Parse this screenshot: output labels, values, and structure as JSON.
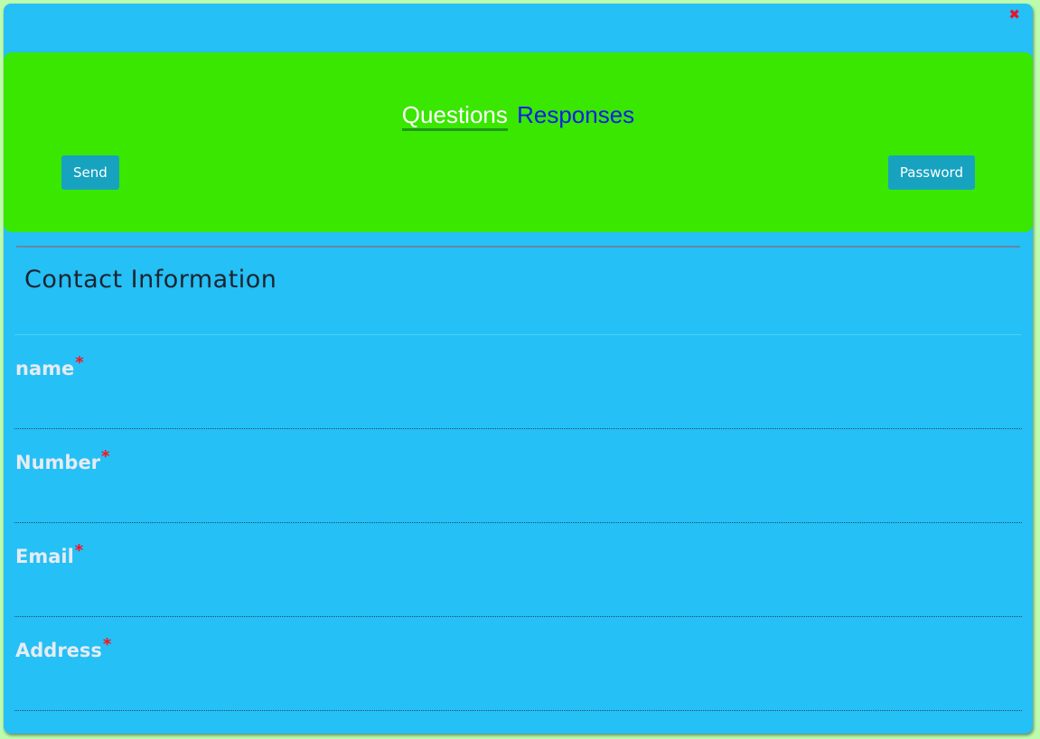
{
  "window": {
    "close_symbol": "✖"
  },
  "header": {
    "tabs": [
      {
        "label": "Questions",
        "active": true
      },
      {
        "label": "Responses",
        "active": false
      }
    ],
    "send_label": "Send",
    "password_label": "Password"
  },
  "section": {
    "title": "Contact Information"
  },
  "fields": [
    {
      "label": "name",
      "required_mark": "*",
      "value": ""
    },
    {
      "label": "Number",
      "required_mark": "*",
      "value": ""
    },
    {
      "label": "Email",
      "required_mark": "*",
      "value": ""
    },
    {
      "label": "Address",
      "required_mark": "*",
      "value": ""
    }
  ],
  "colors": {
    "background": "#bdfbad",
    "window": "#24c0f6",
    "header_panel": "#39e700",
    "button": "#17a3bf",
    "active_tab": "#ffffff",
    "inactive_tab": "#0d1fe8",
    "required": "#ff1020"
  }
}
